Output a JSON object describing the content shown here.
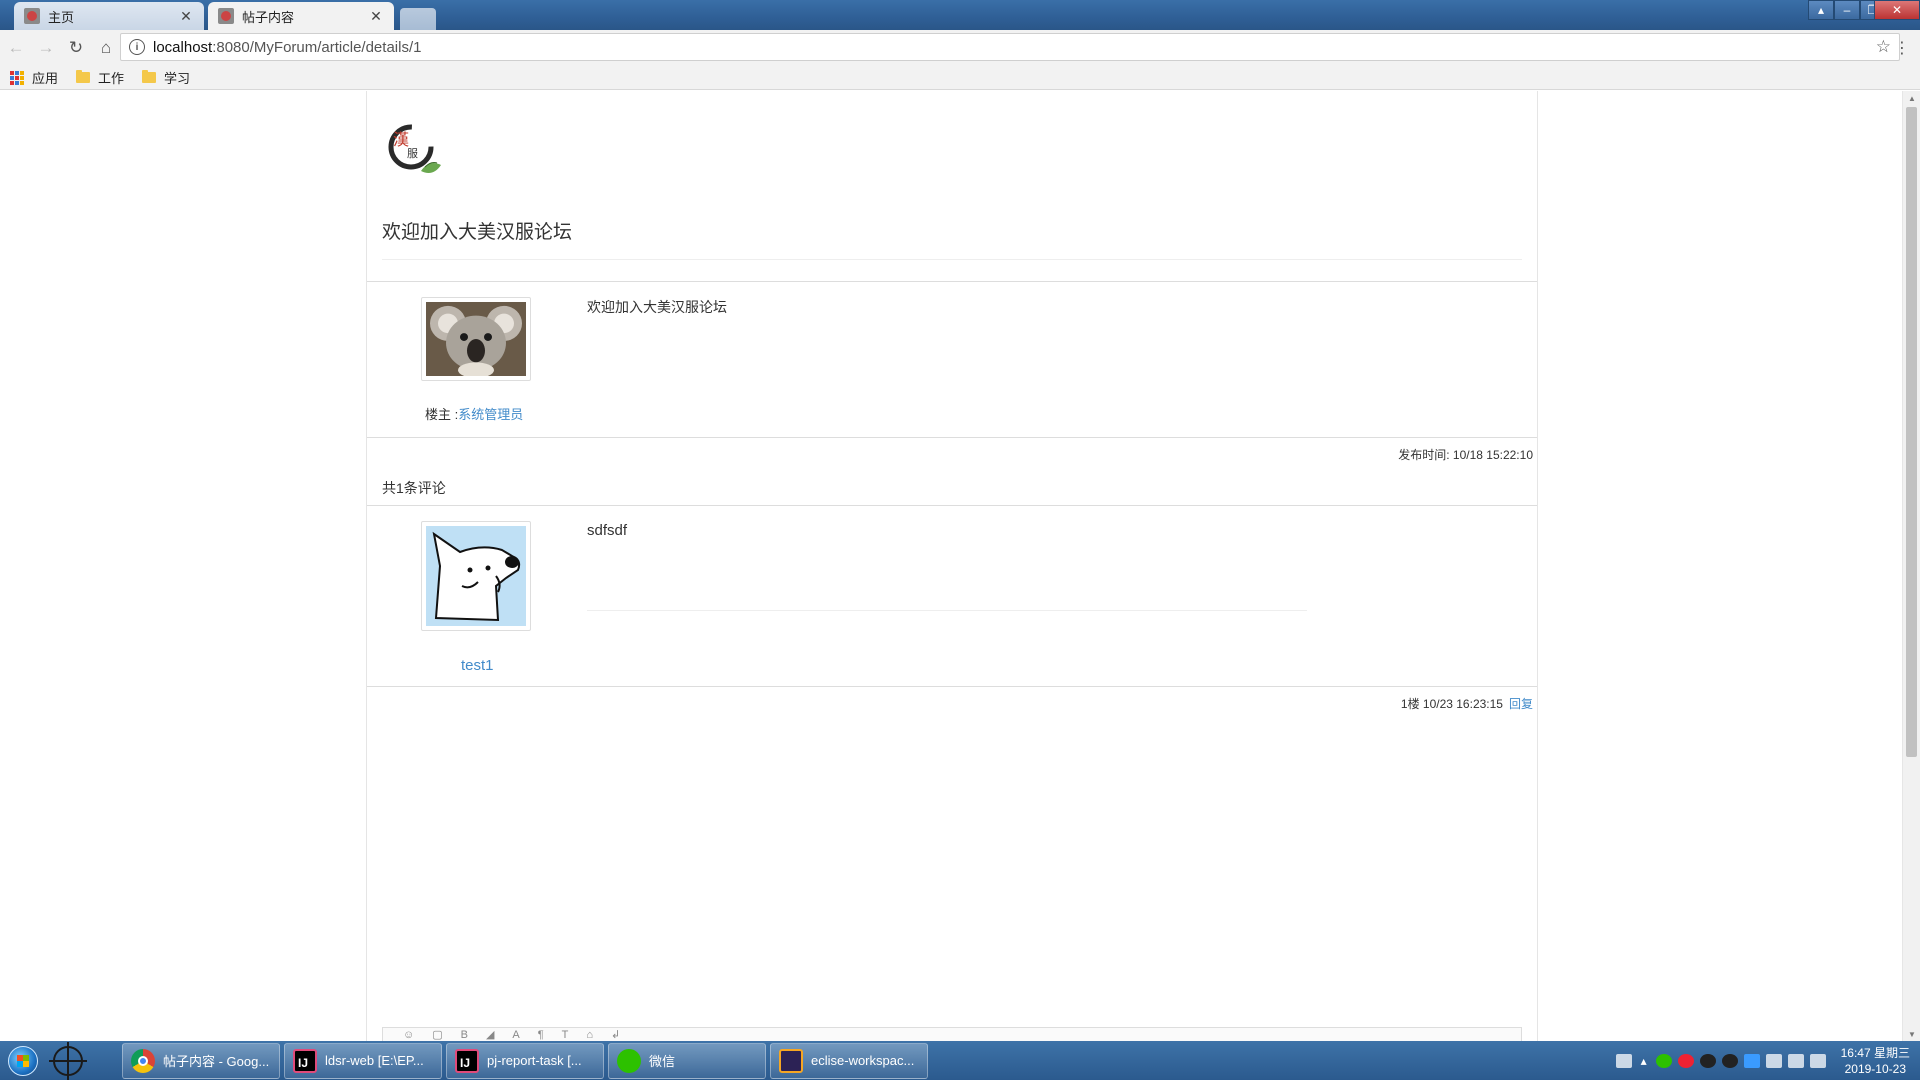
{
  "browser": {
    "tabs": [
      {
        "label": "主页"
      },
      {
        "label": "帖子内容"
      }
    ],
    "url_host": "localhost",
    "url_path": ":8080/MyForum/article/details/1",
    "bookmarks": [
      {
        "label": "应用",
        "icon": "apps-icon"
      },
      {
        "label": "工作",
        "icon": "folder-icon"
      },
      {
        "label": "学习",
        "icon": "folder-icon"
      }
    ]
  },
  "page": {
    "forum_title": "欢迎加入大美汉服论坛",
    "post": {
      "content": "欢迎加入大美汉服论坛",
      "author_prefix": "楼主 :",
      "author": "系统管理员",
      "publish_time": "发布时间: 10/18 15:22:10",
      "avatar": "koala-avatar"
    },
    "comment_count": "共1条评论",
    "comments": [
      {
        "author": "test1",
        "content": "sdfsdf",
        "meta": "1楼 10/23 16:23:15",
        "reply_label": "回复",
        "avatar": "dog-cartoon-avatar"
      }
    ]
  },
  "taskbar": {
    "items": [
      {
        "label": "帖子内容 - Goog...",
        "icon": "chrome-icon"
      },
      {
        "label": "ldsr-web [E:\\EP...",
        "icon": "intellij-icon"
      },
      {
        "label": "pj-report-task [...",
        "icon": "intellij-icon"
      },
      {
        "label": "微信",
        "icon": "wechat-icon"
      },
      {
        "label": "eclise-workspac...",
        "icon": "eclipse-icon"
      }
    ],
    "clock_time": "16:47 星期三",
    "clock_date": "2019-10-23"
  },
  "colors": {
    "link": "#428bca",
    "taskbar": "#2b5a8e",
    "titlebar": "#3a6fa8"
  }
}
